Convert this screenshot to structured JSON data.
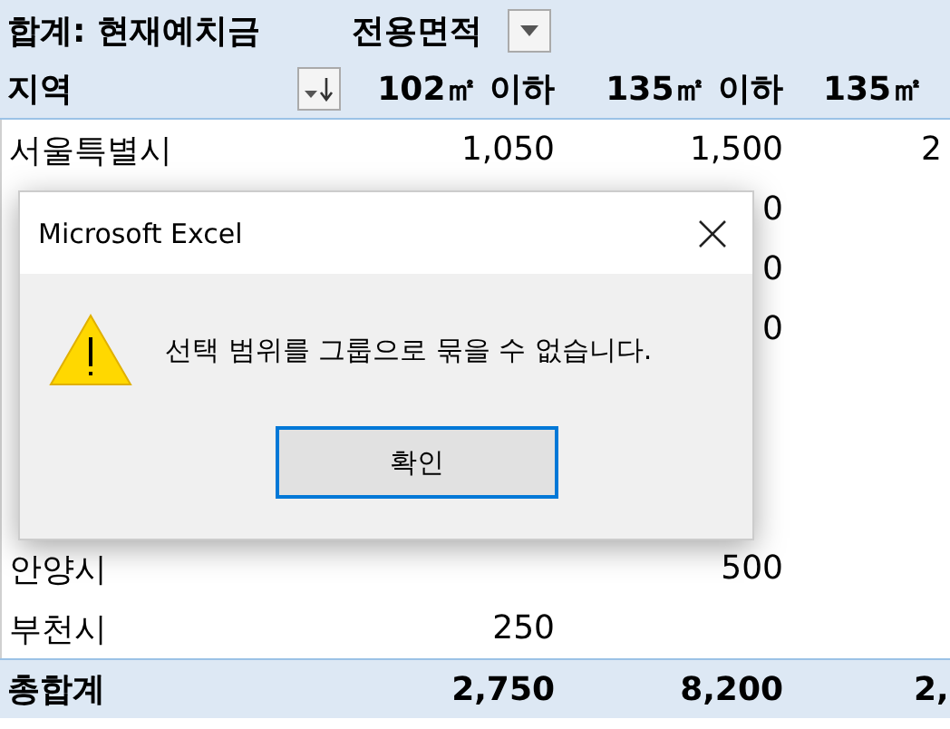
{
  "pivot": {
    "value_label": "합계: 현재예치금",
    "column_field": "전용면적",
    "row_field": "지역",
    "columns": [
      "102㎡ 이하",
      "135㎡ 이하",
      "135㎡"
    ]
  },
  "rows": [
    {
      "region": "서울특별시",
      "up_to_102": "1,050",
      "up_to_135": "1,500",
      "column_4": "2"
    },
    {
      "up_to_135": "0"
    },
    {
      "up_to_135": "0"
    },
    {
      "up_to_135": "0"
    },
    {},
    {},
    {},
    {
      "region": "안양시",
      "up_to_135": "500"
    },
    {
      "region": "부천시",
      "up_to_102": "250"
    }
  ],
  "total": {
    "label": "총합계",
    "values": [
      "2,750",
      "8,200",
      "2,"
    ]
  },
  "dialog": {
    "title": "Microsoft Excel",
    "message": "선택 범위를 그룹으로 묶을 수 없습니다.",
    "button": "확인"
  }
}
